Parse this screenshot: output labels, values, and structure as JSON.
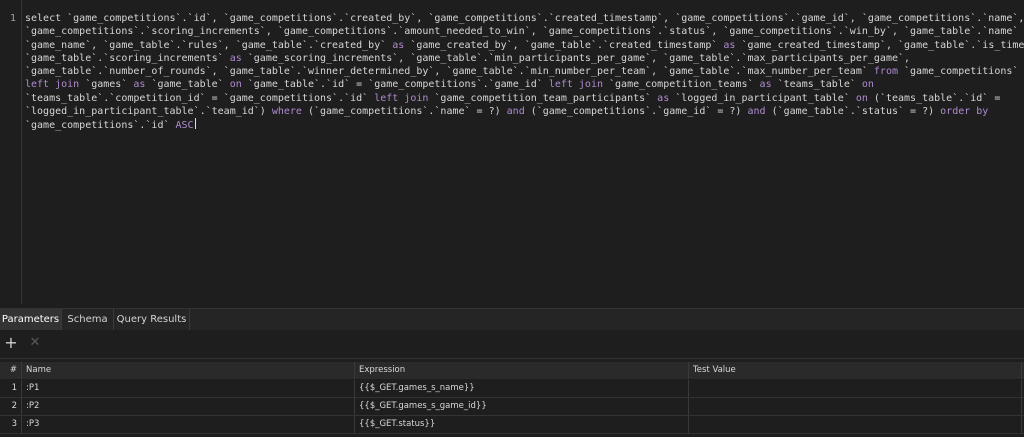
{
  "editor": {
    "line_number": "1",
    "sql_lines": [
      [
        {
          "t": "select `game_competitions`.`id`, `game_competitions`.`created_by`, `game_competitions`.`created_timestamp`, `game_competitions`.`game_id`, `game_competitions`.`name`,"
        }
      ],
      [
        {
          "t": "`game_competitions`.`scoring_increments`, `game_competitions`.`amount_needed_to_win`, `game_competitions`.`status`, `game_competitions`.`win_by`, `game_table`.`name` "
        },
        {
          "t": "as",
          "k": 1
        }
      ],
      [
        {
          "t": "`game_name`, `game_table`.`rules`, `game_table`.`created_by` "
        },
        {
          "t": "as",
          "k": 1
        },
        {
          "t": " `game_created_by`, `game_table`.`created_timestamp` "
        },
        {
          "t": "as",
          "k": 1
        },
        {
          "t": " `game_created_timestamp`, `game_table`.`is_timed`,"
        }
      ],
      [
        {
          "t": "`game_table`.`scoring_increments` "
        },
        {
          "t": "as",
          "k": 1
        },
        {
          "t": " `game_scoring_increments`, `game_table`.`min_participants_per_game`, `game_table`.`max_participants_per_game`,"
        }
      ],
      [
        {
          "t": "`game_table`.`number_of_rounds`, `game_table`.`winner_determined_by`, `game_table`.`min_number_per_team`, `game_table`.`max_number_per_team` "
        },
        {
          "t": "from",
          "k": 1
        },
        {
          "t": " `game_competitions`"
        }
      ],
      [
        {
          "t": "left join",
          "k": 1
        },
        {
          "t": " `games` "
        },
        {
          "t": "as",
          "k": 1
        },
        {
          "t": " `game_table` "
        },
        {
          "t": "on",
          "k": 1
        },
        {
          "t": " `game_table`.`id` = `game_competitions`.`game_id` "
        },
        {
          "t": "left join",
          "k": 1
        },
        {
          "t": " `game_competition_teams` "
        },
        {
          "t": "as",
          "k": 1
        },
        {
          "t": " `teams_table` "
        },
        {
          "t": "on",
          "k": 1
        }
      ],
      [
        {
          "t": "`teams_table`.`competition_id` = `game_competitions`.`id` "
        },
        {
          "t": "left join",
          "k": 1
        },
        {
          "t": " `game_competition_team_participants` "
        },
        {
          "t": "as",
          "k": 1
        },
        {
          "t": " `logged_in_participant_table` "
        },
        {
          "t": "on",
          "k": 1
        },
        {
          "t": " (`teams_table`.`id` ="
        }
      ],
      [
        {
          "t": "`logged_in_participant_table`.`team_id`) "
        },
        {
          "t": "where",
          "k": 1
        },
        {
          "t": " (`game_competitions`.`name` = ?) "
        },
        {
          "t": "and",
          "k": 1
        },
        {
          "t": " (`game_competitions`.`game_id` = ?) "
        },
        {
          "t": "and",
          "k": 1
        },
        {
          "t": " (`game_table`.`status` = ?) "
        },
        {
          "t": "order by",
          "k": 1
        }
      ],
      [
        {
          "t": "`game_competitions`.`id` "
        },
        {
          "t": "ASC",
          "k": 1
        }
      ]
    ]
  },
  "tabs": [
    {
      "label": "Parameters",
      "active": true
    },
    {
      "label": "Schema",
      "active": false
    },
    {
      "label": "Query Results",
      "active": false
    }
  ],
  "toolbar": {
    "add_symbol": "+",
    "remove_symbol": "✕"
  },
  "table": {
    "headers": {
      "num": "#",
      "name": "Name",
      "expression": "Expression",
      "test_value": "Test Value"
    },
    "rows": [
      {
        "num": "1",
        "name": ":P1",
        "expression": "{{$_GET.games_s_name}}",
        "test_value": ""
      },
      {
        "num": "2",
        "name": ":P2",
        "expression": "{{$_GET.games_s_game_id}}",
        "test_value": ""
      },
      {
        "num": "3",
        "name": ":P3",
        "expression": "{{$_GET.status}}",
        "test_value": ""
      }
    ]
  },
  "colors": {
    "keyword": "#b08bd0",
    "text": "#d6d6d6",
    "background": "#1e1e1e"
  }
}
